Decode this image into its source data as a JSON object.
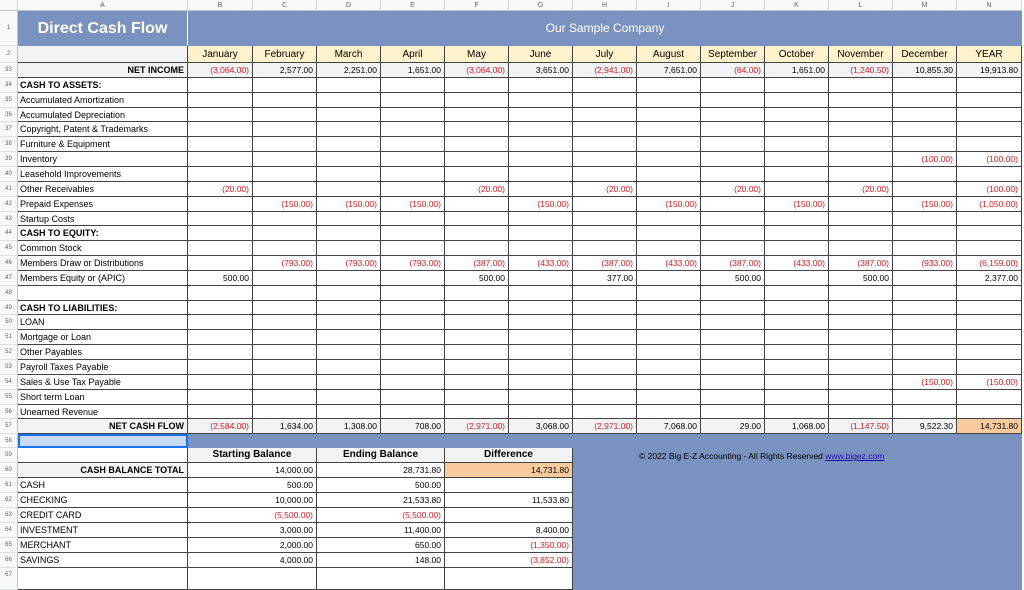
{
  "columns": [
    "A",
    "B",
    "C",
    "D",
    "E",
    "F",
    "G",
    "H",
    "I",
    "J",
    "K",
    "L",
    "M",
    "N"
  ],
  "title": "Direct Cash Flow",
  "company": "Our Sample Company",
  "months": [
    "January",
    "February",
    "March",
    "April",
    "May",
    "June",
    "July",
    "August",
    "September",
    "October",
    "November",
    "December",
    "YEAR"
  ],
  "rows": [
    {
      "n": "33",
      "label": "NET INCOME",
      "kind": "total",
      "vals": [
        "(3,064.00)",
        "2,577.00",
        "2,251.00",
        "1,651.00",
        "(3,064.00)",
        "3,651.00",
        "(2,941.00)",
        "7,651.00",
        "(64.00)",
        "1,651.00",
        "(1,240.50)",
        "10,855.30",
        "19,913.80"
      ]
    },
    {
      "n": "34",
      "label": "CASH TO ASSETS:",
      "kind": "section",
      "vals": []
    },
    {
      "n": "35",
      "label": "Accumulated Amortization",
      "kind": "item",
      "vals": []
    },
    {
      "n": "36",
      "label": "Accumulated Depreciation",
      "kind": "item",
      "vals": []
    },
    {
      "n": "37",
      "label": "Copyright, Patent & Trademarks",
      "kind": "item",
      "vals": []
    },
    {
      "n": "38",
      "label": "Furniture & Equipment",
      "kind": "item",
      "vals": []
    },
    {
      "n": "39",
      "label": "Inventory",
      "kind": "item",
      "vals": [
        "",
        "",
        "",
        "",
        "",
        "",
        "",
        "",
        "",
        "",
        "",
        "(100.00)",
        "(100.00)"
      ]
    },
    {
      "n": "40",
      "label": "Leasehold Improvements",
      "kind": "item",
      "vals": []
    },
    {
      "n": "41",
      "label": "Other Receivables",
      "kind": "item",
      "vals": [
        "(20.00)",
        "",
        "",
        "",
        "(20.00)",
        "",
        "(20.00)",
        "",
        "(20.00)",
        "",
        "(20.00)",
        "",
        "(100.00)"
      ]
    },
    {
      "n": "42",
      "label": "Prepaid Expenses",
      "kind": "item",
      "vals": [
        "",
        "(150.00)",
        "(150.00)",
        "(150.00)",
        "",
        "(150.00)",
        "",
        "(150.00)",
        "",
        "(150.00)",
        "",
        "(150.00)",
        "(1,050.00)"
      ]
    },
    {
      "n": "43",
      "label": "Startup Costs",
      "kind": "item",
      "vals": []
    },
    {
      "n": "44",
      "label": "CASH TO EQUITY:",
      "kind": "section",
      "vals": []
    },
    {
      "n": "45",
      "label": "Common Stock",
      "kind": "item",
      "vals": []
    },
    {
      "n": "46",
      "label": "Members Draw or Distributions",
      "kind": "item",
      "vals": [
        "",
        "(793.00)",
        "(793.00)",
        "(793.00)",
        "(387.00)",
        "(433.00)",
        "(387.00)",
        "(433.00)",
        "(387.00)",
        "(433.00)",
        "(387.00)",
        "(933.00)",
        "(6,159.00)"
      ]
    },
    {
      "n": "47",
      "label": "Members Equity or (APIC)",
      "kind": "item",
      "vals": [
        "500.00",
        "",
        "",
        "",
        "500.00",
        "",
        "377.00",
        "",
        "500.00",
        "",
        "500.00",
        "",
        "2,377.00"
      ]
    },
    {
      "n": "48",
      "label": "",
      "kind": "item",
      "vals": []
    },
    {
      "n": "49",
      "label": "CASH TO LIABILITIES:",
      "kind": "section",
      "vals": []
    },
    {
      "n": "50",
      "label": "LOAN",
      "kind": "item",
      "vals": []
    },
    {
      "n": "51",
      "label": "Mortgage or Loan",
      "kind": "item",
      "vals": []
    },
    {
      "n": "52",
      "label": "Other Payables",
      "kind": "item",
      "vals": []
    },
    {
      "n": "53",
      "label": "Payroll Taxes Payable",
      "kind": "item",
      "vals": []
    },
    {
      "n": "54",
      "label": "Sales & Use Tax Payable",
      "kind": "item",
      "vals": [
        "",
        "",
        "",
        "",
        "",
        "",
        "",
        "",
        "",
        "",
        "",
        "(150.00)",
        "(150.00)"
      ]
    },
    {
      "n": "55",
      "label": "Short term Loan",
      "kind": "item",
      "vals": []
    },
    {
      "n": "56",
      "label": "Unearned Revenue",
      "kind": "item",
      "vals": []
    },
    {
      "n": "57",
      "label": "NET CASH FLOW",
      "kind": "total",
      "vals": [
        "(2,584.00)",
        "1,634.00",
        "1,308.00",
        "708.00",
        "(2,971.00)",
        "3,068.00",
        "(2,971.00)",
        "7,068.00",
        "29.00",
        "1,068.00",
        "(1,147.50)",
        "9,522.30",
        "14,731.80"
      ]
    }
  ],
  "balance": {
    "headers": [
      "Starting Balance",
      "Ending Balance",
      "Difference"
    ],
    "total": {
      "n": "60",
      "label": "CASH BALANCE TOTAL",
      "vals": [
        "14,000.00",
        "28,731.80",
        "14,731.80"
      ]
    },
    "rows": [
      {
        "n": "61",
        "label": "CASH",
        "vals": [
          "500.00",
          "500.00",
          ""
        ]
      },
      {
        "n": "62",
        "label": "CHECKING",
        "vals": [
          "10,000.00",
          "21,533.80",
          "11,533.80"
        ]
      },
      {
        "n": "63",
        "label": "CREDIT CARD",
        "vals": [
          "(5,500.00)",
          "(5,500.00)",
          ""
        ]
      },
      {
        "n": "64",
        "label": "INVESTMENT",
        "vals": [
          "3,000.00",
          "11,400.00",
          "8,400.00"
        ]
      },
      {
        "n": "65",
        "label": "MERCHANT",
        "vals": [
          "2,000.00",
          "650.00",
          "(1,350.00)"
        ]
      },
      {
        "n": "66",
        "label": "SAVINGS",
        "vals": [
          "4,000.00",
          "148.00",
          "(3,852.00)"
        ]
      }
    ]
  },
  "copyright": "© 2022 Big E-Z Accounting - All Rights Reserved",
  "copyright_link": "www.bigez.com",
  "extra_rows": [
    "1",
    "2",
    "58",
    "59",
    "67"
  ],
  "colors": {
    "header_blue": "#7a92bf",
    "month_bg": "#fff2cc",
    "year_total_bg": "#f9cb9c",
    "negative": "#e8161b",
    "gray_fill": "#f1f3f4"
  }
}
